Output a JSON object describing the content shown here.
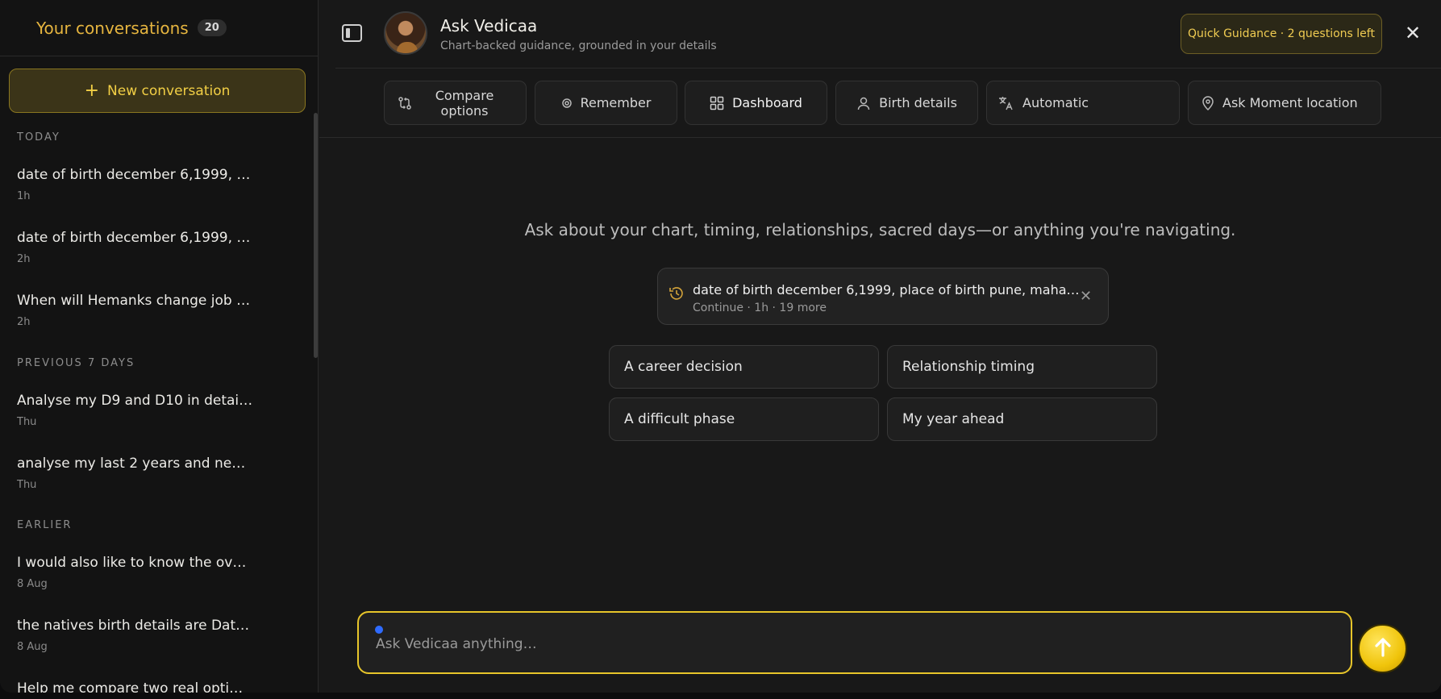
{
  "sidebar": {
    "title": "Your conversations",
    "count": "20",
    "new_label": "New conversation",
    "groups": [
      {
        "label": "TODAY"
      },
      {
        "label": "PREVIOUS 7 DAYS"
      },
      {
        "label": "EARLIER"
      }
    ],
    "items": [
      {
        "title": "date of birth december 6,1999, …",
        "time": "1h"
      },
      {
        "title": "date of birth december 6,1999, …",
        "time": "2h"
      },
      {
        "title": "When will Hemanks change job …",
        "time": "2h"
      },
      {
        "title": "Analyse my D9 and D10 in detai…",
        "time": "Thu"
      },
      {
        "title": "analyse my last 2 years and ne…",
        "time": "Thu"
      },
      {
        "title": "I would also like to know the ov…",
        "time": "8 Aug"
      },
      {
        "title": "the natives birth details are Dat…",
        "time": "8 Aug"
      },
      {
        "title": "Help me compare two real opti…",
        "time": ""
      }
    ]
  },
  "header": {
    "name": "Ask Vedicaa",
    "subtitle": "Chart-backed guidance, grounded in your details",
    "quota": "Quick Guidance · 2 questions left",
    "close": "✕"
  },
  "toolbar": {
    "compare": "Compare options",
    "remember": "Remember",
    "dashboard": "Dashboard",
    "birth": "Birth details",
    "language": "Automatic",
    "location": "Ask Moment location"
  },
  "main": {
    "prompt": "Ask about your chart, timing, relationships, sacred days—or anything you're navigating.",
    "resume": {
      "title": "date of birth december 6,1999, place of birth pune, maha…",
      "meta": "Continue · 1h · 19 more"
    },
    "suggestions": [
      "A career decision",
      "Relationship timing",
      "A difficult phase",
      "My year ahead"
    ]
  },
  "composer": {
    "placeholder": "Ask Vedicaa anything…"
  },
  "icons": {
    "toggle": "sidebar-toggle-icon",
    "compare": "compare-icon",
    "remember": "remember-icon",
    "dashboard": "dashboard-grid-icon",
    "birth": "person-icon",
    "language": "translate-icon",
    "location": "map-pin-icon",
    "history": "history-icon",
    "send": "arrow-up-icon"
  },
  "colors": {
    "accent": "#e7c52a",
    "gold_text": "#e6b53f",
    "background": "#181818"
  }
}
